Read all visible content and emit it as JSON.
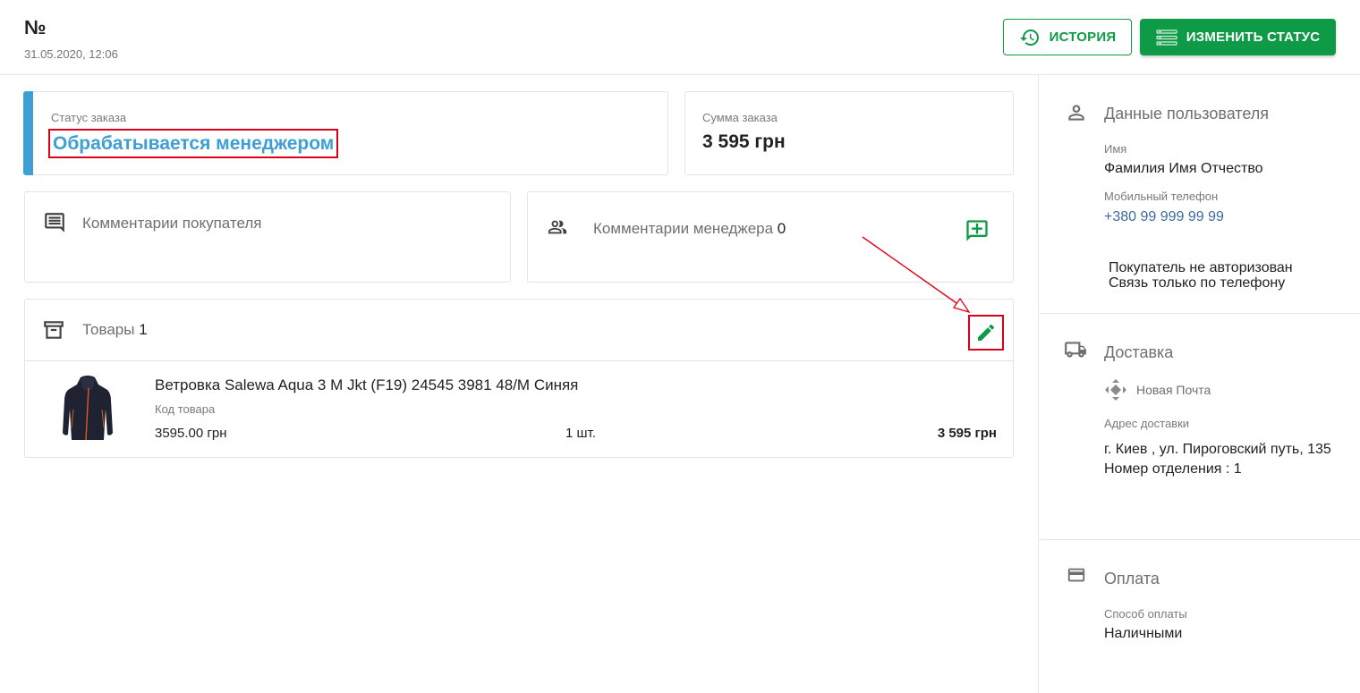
{
  "header": {
    "order_number": "№",
    "order_date": "31.05.2020, 12:06",
    "history_label": "ИСТОРИЯ",
    "change_status_label": "ИЗМЕНИТЬ СТАТУС"
  },
  "status": {
    "label": "Статус заказа",
    "value": "Обрабатывается менеджером"
  },
  "sum": {
    "label": "Сумма заказа",
    "value": "3 595 грн"
  },
  "buyer_comments": {
    "title": "Комментарии покупателя"
  },
  "manager_comments": {
    "title": "Комментарии менеджера",
    "count": "0"
  },
  "products": {
    "title": "Товары",
    "count": "1",
    "items": [
      {
        "name": "Ветровка Salewa Aqua 3 M Jkt (F19) 24545 3981 48/M Синяя",
        "code_label": "Код товара",
        "price": "3595.00 грн",
        "quantity": "1 шт.",
        "total": "3 595 грн"
      }
    ]
  },
  "customer": {
    "title": "Данные пользователя",
    "name_label": "Имя",
    "name_value": "Фамилия Имя Отчество",
    "phone_label": "Мобильный телефон",
    "phone_value": "+380 99 999 99 99",
    "note_line1": "Покупатель не авторизован",
    "note_line2": "Связь только по телефону"
  },
  "delivery": {
    "title": "Доставка",
    "carrier": "Новая Почта",
    "address_label": "Адрес доставки",
    "address_line1": "г. Киев , ул. Пироговский путь, 135",
    "address_line2": "Номер отделения : 1"
  },
  "payment": {
    "title": "Оплата",
    "method_label": "Способ оплаты",
    "method_value": "Наличными"
  },
  "icons": [
    "history-icon",
    "list-icon",
    "comment-icon",
    "people-icon",
    "add-comment-icon",
    "archive-icon",
    "edit-icon",
    "person-icon",
    "truck-icon",
    "nova-poshta-icon",
    "card-icon"
  ],
  "colors": {
    "accent_green": "#0e9a47",
    "status_blue": "#3d9fd6",
    "highlight_red": "#d9001b",
    "phone_blue": "#3f6aa0"
  }
}
